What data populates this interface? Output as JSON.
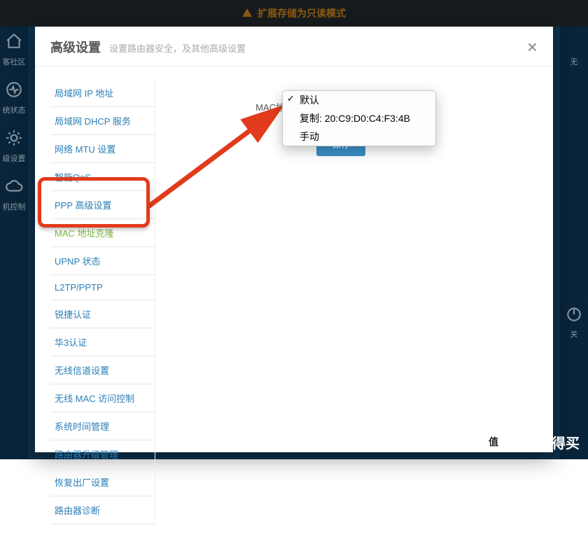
{
  "topbar": {
    "warning": "扩展存储为只读模式"
  },
  "bg_sidebar": {
    "items": [
      {
        "name": "community",
        "label": "客社区"
      },
      {
        "name": "status",
        "label": "统状态"
      },
      {
        "name": "advanced",
        "label": "级设置"
      },
      {
        "name": "control",
        "label": "机控制"
      }
    ],
    "right_items": [
      {
        "name": "wireless",
        "label": "无"
      },
      {
        "name": "power",
        "label": "关"
      }
    ]
  },
  "modal": {
    "title": "高级设置",
    "subtitle": "设置路由器安全，及其他高级设置",
    "close_label": "×"
  },
  "nav": {
    "items": [
      "局域网 IP 地址",
      "局域网 DHCP 服务",
      "网络 MTU 设置",
      "智能QoS",
      "PPP 高级设置",
      "MAC 地址克隆",
      "UPNP 状态",
      "L2TP/PPTP",
      "锐捷认证",
      "华3认证",
      "无线信道设置",
      "无线 MAC 访问控制",
      "系统时间管理",
      "路由器升级管理",
      "恢复出厂设置",
      "路由器诊断"
    ],
    "active_index": 5
  },
  "form": {
    "mac_clone_label": "MAC地址克隆",
    "save_button": "保存"
  },
  "dropdown": {
    "options": [
      {
        "label": "默认",
        "selected": true
      },
      {
        "label": "复制: 20:C9:D0:C4:F3:4B",
        "selected": false
      },
      {
        "label": "手动",
        "selected": false
      }
    ]
  },
  "watermark": {
    "badge": "值",
    "text": "什么值得买"
  }
}
